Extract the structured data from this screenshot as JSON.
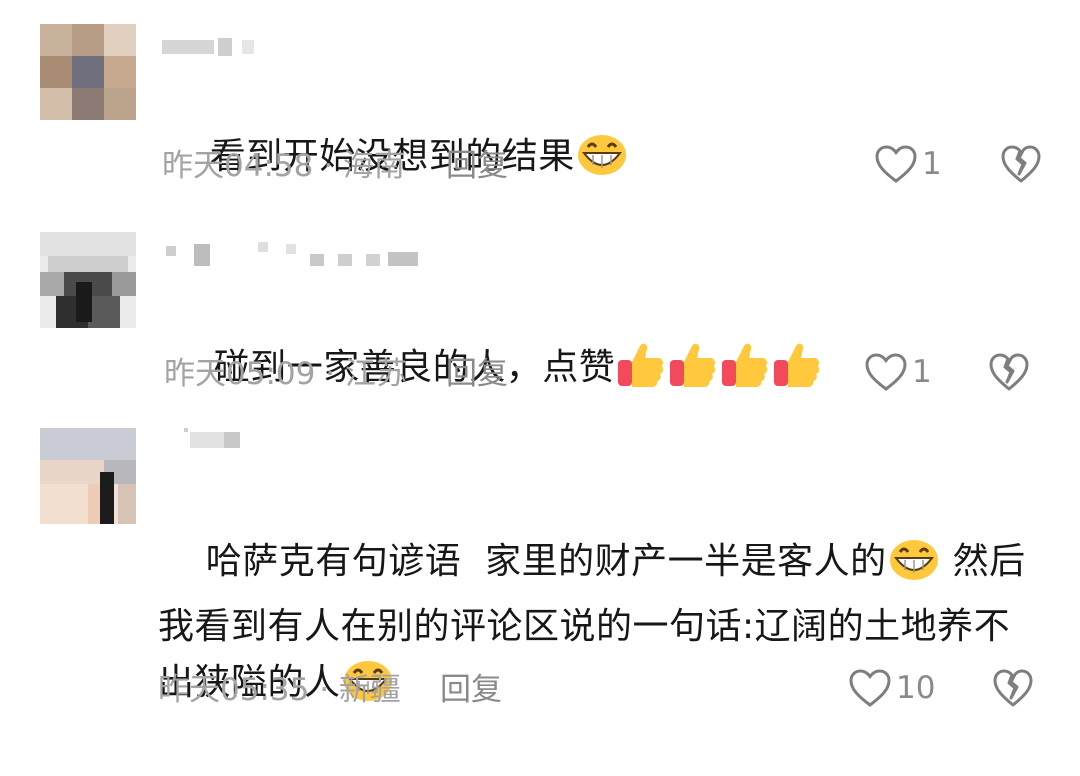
{
  "comments": [
    {
      "text_segments": [
        "看到开始没想到的结果"
      ],
      "time": "昨天04:58",
      "separator": "·",
      "location": "海南",
      "reply_label": "回复",
      "like_count": "1",
      "emojis": [
        "grin-emoji"
      ]
    },
    {
      "text_segments": [
        "碰到一家善良的人，点赞"
      ],
      "time": "昨天05:09",
      "separator": "·",
      "location": "江苏",
      "reply_label": "回复",
      "like_count": "1",
      "emojis": [
        "thumbs-up-emoji",
        "thumbs-up-emoji",
        "thumbs-up-emoji",
        "thumbs-up-emoji"
      ]
    },
    {
      "text_segments": [
        "哈萨克有句谚语  家里的财产一半是客人的",
        " 然后我看到有人在别的评论区说的一句话:辽阔的土地养不出狭隘的人"
      ],
      "time": "昨天05:35",
      "separator": "·",
      "location": "新疆",
      "reply_label": "回复",
      "like_count": "10",
      "emojis": [
        "grin-emoji",
        "grin-emoji"
      ]
    }
  ],
  "colors": {
    "text": "#171717",
    "meta": "#a3a3a3",
    "action": "#8a8a8a",
    "emoji_face": "#ffc83d"
  }
}
